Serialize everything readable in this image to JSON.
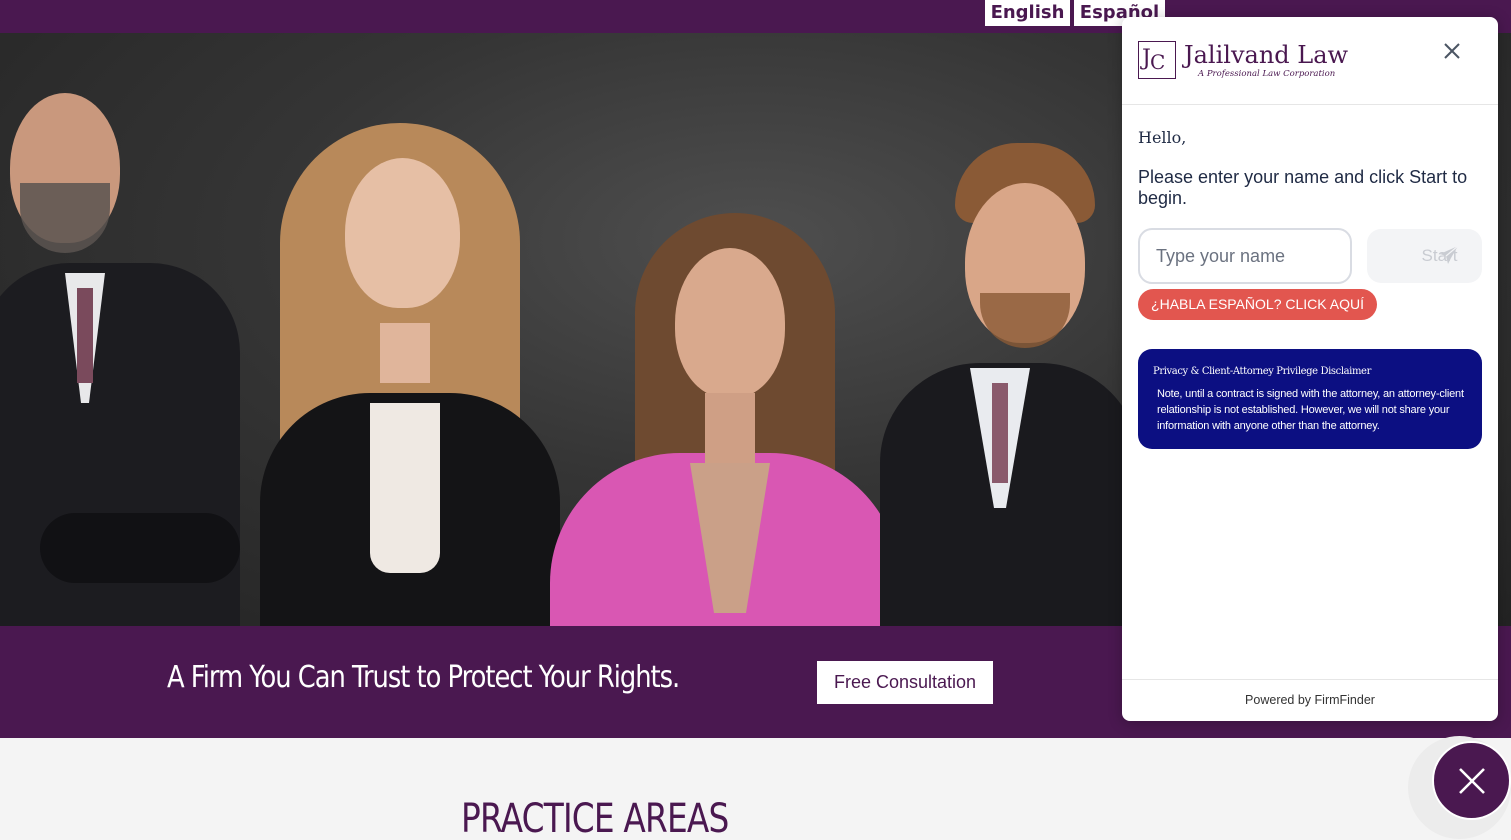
{
  "colors": {
    "brand_purple": "#4a1850",
    "white": "#ffffff",
    "page_background": "#f4f4f4",
    "chat_text": "#1f2a44",
    "spanish_button": "#e2564f",
    "disclaimer_background": "#0c0f82"
  },
  "language_switcher": {
    "english_label": "English",
    "spanish_label": "Español"
  },
  "hero": {
    "image_description_icon": "team-photo"
  },
  "banner": {
    "tagline": "A Firm You Can Trust to Protect Your Rights.",
    "consultation_button_label": "Free Consultation"
  },
  "main": {
    "section_title": "PRACTICE AREAS"
  },
  "chat": {
    "logo_monogram": "JLC",
    "logo_name": "Jalilvand Law",
    "logo_subtitle": "A Professional Law Corporation",
    "greeting": "Hello,",
    "instructions": "Please enter your name and click Start to begin.",
    "name_placeholder": "Type your name",
    "start_label": "Start",
    "spanish_button_label": "¿HABLA ESPAÑOL? CLICK AQUÍ",
    "disclaimer_title": "Privacy & Client-Attorney Privilege Disclaimer",
    "disclaimer_body": "Note, until a contract is signed with the attorney, an attorney-client relationship is not established. However, we will not share your information with anyone other than the attorney.",
    "footer_text": "Powered by FirmFinder",
    "close_icon": "close-icon",
    "send_icon": "paper-plane-icon"
  },
  "chat_launcher": {
    "icon": "close-icon"
  }
}
